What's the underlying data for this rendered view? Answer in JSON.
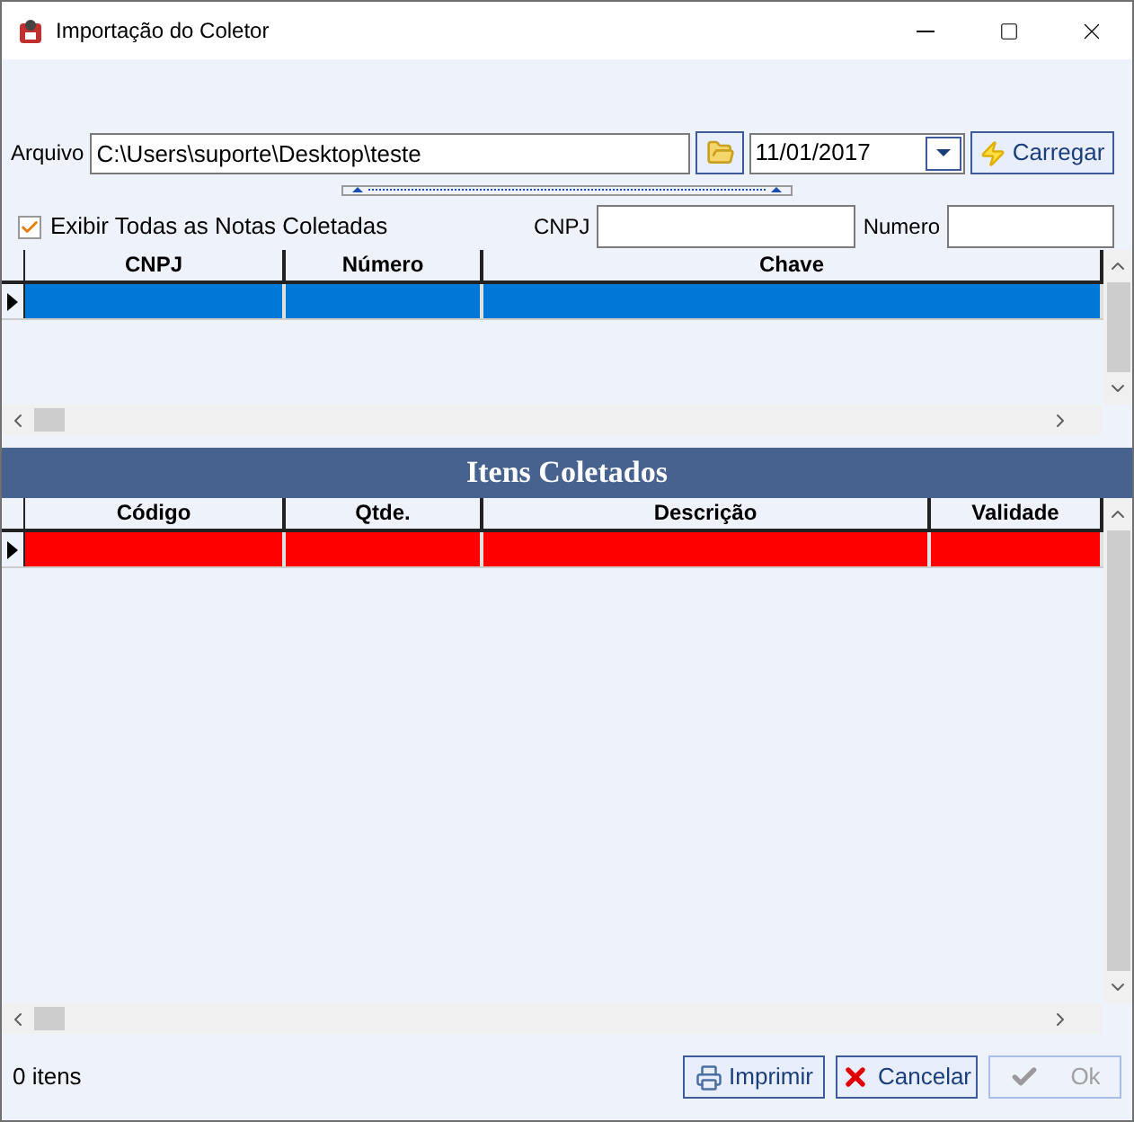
{
  "window": {
    "title": "Importação do Coletor"
  },
  "file": {
    "label": "Arquivo",
    "value": "C:\\Users\\suporte\\Desktop\\teste",
    "date": "11/01/2017",
    "load_button": "Carregar"
  },
  "filter": {
    "show_all": {
      "label": "Exibir Todas as Notas Coletadas",
      "checked": true
    },
    "cnpj_label": "CNPJ",
    "numero_label": "Numero"
  },
  "notes_grid": {
    "columns": [
      "CNPJ",
      "Número",
      "Chave"
    ],
    "rows": [
      {
        "selected": true
      }
    ]
  },
  "items_title": "Itens Coletados",
  "items_grid": {
    "columns": [
      "Código",
      "Qtde.",
      "Descrição",
      "Validade"
    ],
    "rows": [
      {
        "selected": true
      }
    ]
  },
  "status": "0 itens",
  "buttons": [
    {
      "kind": "print",
      "label": "Imprimir",
      "disabled": false
    },
    {
      "kind": "cancel",
      "label": "Cancelar",
      "disabled": false
    },
    {
      "kind": "ok",
      "label": "Ok",
      "disabled": true
    }
  ]
}
